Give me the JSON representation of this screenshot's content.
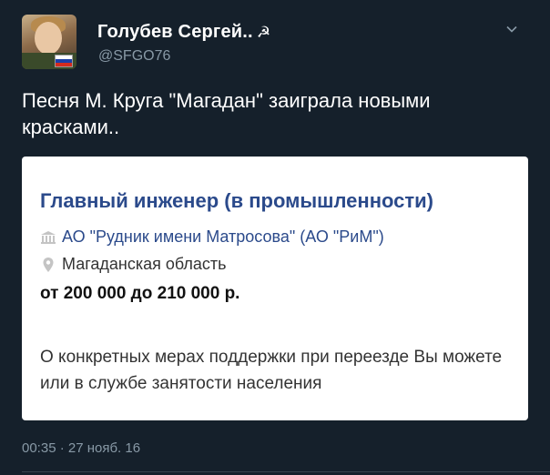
{
  "author": {
    "name": "Голубев Сергей..",
    "name_symbol": "☭",
    "handle": "@SFGO76"
  },
  "tweet": {
    "text": "Песня М. Круга \"Магадан\" заиграла новыми красками..",
    "timestamp": "00:35 · 27 нояб. 16"
  },
  "card": {
    "title": "Главный инженер (в промышленности)",
    "company": "АО \"Рудник имени Матросова\" (АО \"РиМ\")",
    "region": "Магаданская область",
    "salary": "от 200 000 до 210 000 р.",
    "description_line1": "О конкретных мерах поддержки при переезде Вы можете",
    "description_line2": "или в службе занятости населения"
  },
  "icons": {
    "avatar": "profile-photo",
    "flag": "russian-flag-icon",
    "chevron": "chevron-down-icon",
    "company": "building-icon",
    "location": "location-pin-icon"
  },
  "colors": {
    "background": "#15202b",
    "card_title": "#2b4a8b",
    "muted": "#8899a6"
  }
}
